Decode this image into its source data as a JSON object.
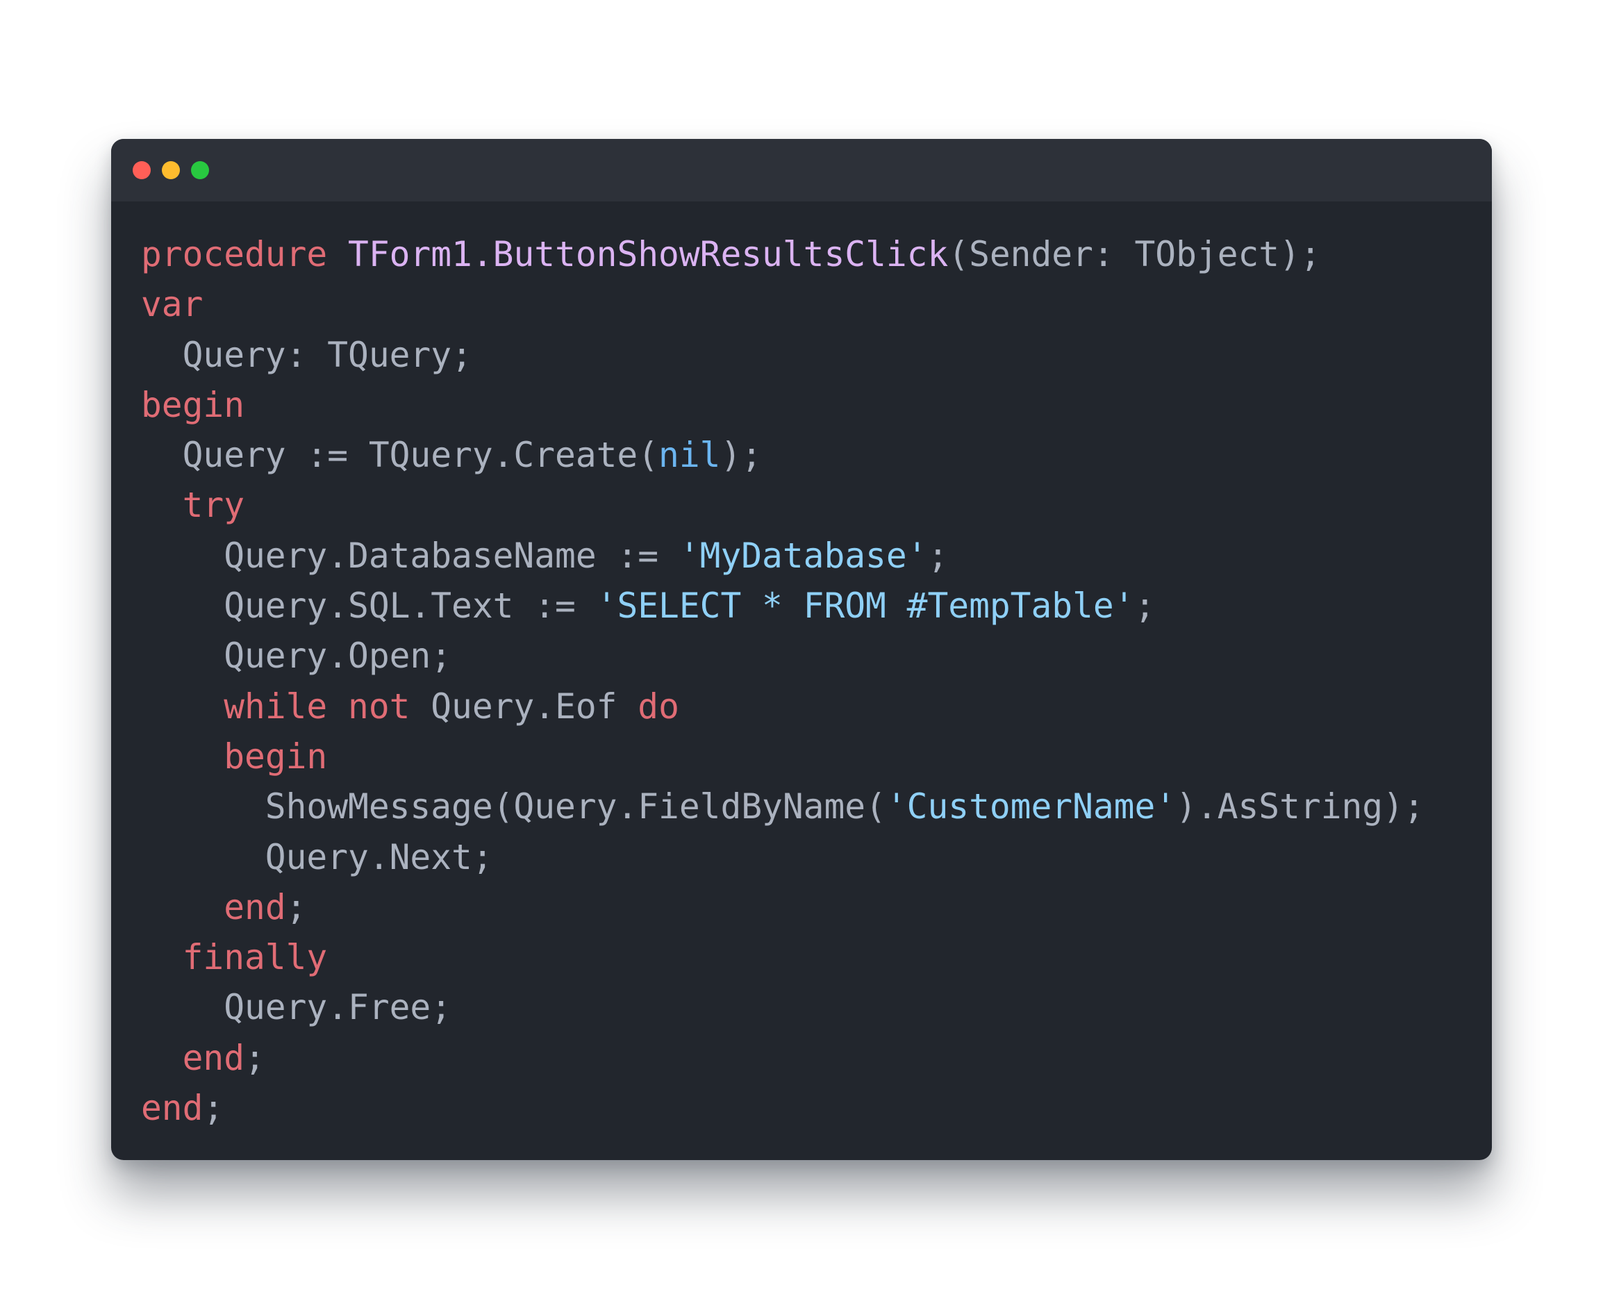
{
  "window": {
    "controls": [
      {
        "name": "close-button",
        "color": "#ff5f57"
      },
      {
        "name": "minimize-button",
        "color": "#febc2e"
      },
      {
        "name": "maximize-button",
        "color": "#28c840"
      }
    ]
  },
  "colors": {
    "keyword": "#e06c75",
    "function": "#dbb3f2",
    "string": "#8fd0f7",
    "literal": "#6cb5f0",
    "plain": "#abb2bf",
    "background": "#22262d",
    "titlebar": "#2d3139"
  },
  "code": {
    "language": "Pascal",
    "lines": [
      [
        [
          "kw",
          "procedure"
        ],
        [
          "plain",
          " "
        ],
        [
          "fn",
          "TForm1.ButtonShowResultsClick"
        ],
        [
          "plain",
          "(Sender: TObject);"
        ]
      ],
      [
        [
          "kw",
          "var"
        ]
      ],
      [
        [
          "plain",
          "  Query: TQuery;"
        ]
      ],
      [
        [
          "kw",
          "begin"
        ]
      ],
      [
        [
          "plain",
          "  Query := TQuery.Create("
        ],
        [
          "lit",
          "nil"
        ],
        [
          "plain",
          ");"
        ]
      ],
      [
        [
          "plain",
          "  "
        ],
        [
          "kw",
          "try"
        ]
      ],
      [
        [
          "plain",
          "    Query.DatabaseName := "
        ],
        [
          "str",
          "'MyDatabase'"
        ],
        [
          "plain",
          ";"
        ]
      ],
      [
        [
          "plain",
          "    Query.SQL.Text := "
        ],
        [
          "str",
          "'SELECT * FROM #TempTable'"
        ],
        [
          "plain",
          ";"
        ]
      ],
      [
        [
          "plain",
          "    Query.Open;"
        ]
      ],
      [
        [
          "plain",
          "    "
        ],
        [
          "kw",
          "while"
        ],
        [
          "plain",
          " "
        ],
        [
          "kw",
          "not"
        ],
        [
          "plain",
          " Query.Eof "
        ],
        [
          "kw",
          "do"
        ]
      ],
      [
        [
          "plain",
          "    "
        ],
        [
          "kw",
          "begin"
        ]
      ],
      [
        [
          "plain",
          "      ShowMessage(Query.FieldByName("
        ],
        [
          "str",
          "'CustomerName'"
        ],
        [
          "plain",
          ").AsString);"
        ]
      ],
      [
        [
          "plain",
          "      Query.Next;"
        ]
      ],
      [
        [
          "plain",
          "    "
        ],
        [
          "kw",
          "end"
        ],
        [
          "plain",
          ";"
        ]
      ],
      [
        [
          "plain",
          "  "
        ],
        [
          "kw",
          "finally"
        ]
      ],
      [
        [
          "plain",
          "    Query.Free;"
        ]
      ],
      [
        [
          "plain",
          "  "
        ],
        [
          "kw",
          "end"
        ],
        [
          "plain",
          ";"
        ]
      ],
      [
        [
          "kw",
          "end"
        ],
        [
          "plain",
          ";"
        ]
      ]
    ]
  }
}
